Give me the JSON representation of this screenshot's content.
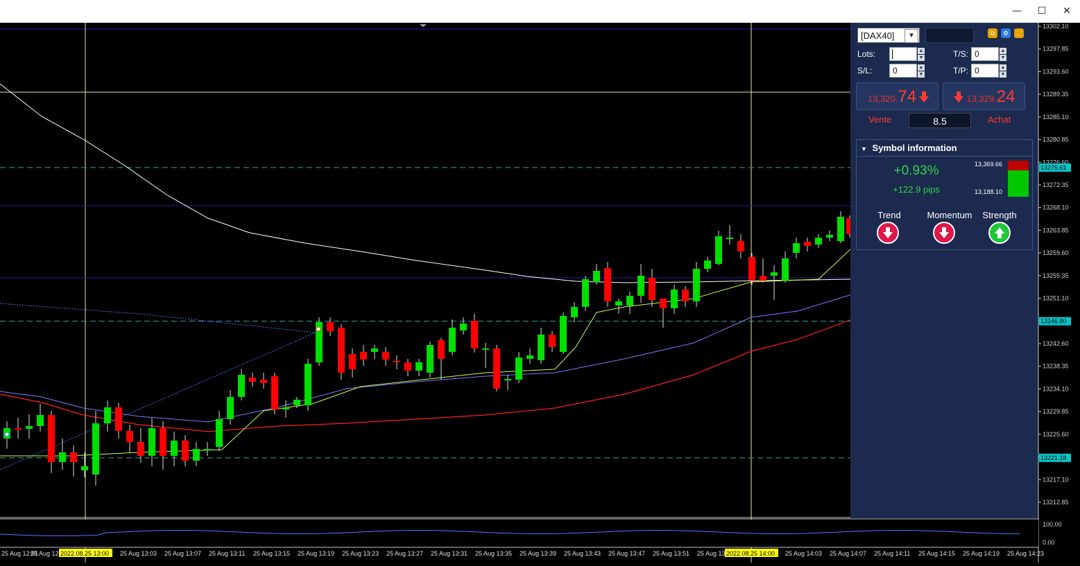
{
  "window": {
    "minimize_glyph": "—",
    "maximize_glyph": "☐",
    "close_glyph": "✕"
  },
  "chart": {
    "price_axis": [
      "13302.10",
      "13297.85",
      "13293.60",
      "13289.35",
      "13285.10",
      "13280.85",
      "13276.60",
      "13272.35",
      "13268.10",
      "13263.85",
      "13259.60",
      "13255.35",
      "13251.10",
      "13246.85",
      "13242.60",
      "13238.35",
      "13234.10",
      "13229.85",
      "13225.60",
      "13221.35",
      "13217.10",
      "13212.85"
    ],
    "price_markers": [
      {
        "value": "13275.61",
        "color": "#00c6c8"
      },
      {
        "value": "13246.80",
        "color": "#00c6c8"
      },
      {
        "value": "13221.18",
        "color": "#00c6c8"
      }
    ],
    "time_axis": [
      "25 Aug 12:51",
      "25 Aug 12",
      "2022.08.25 13:00",
      "25 Aug 13:03",
      "25 Aug 13:07",
      "25 Aug 13:11",
      "25 Aug 13:15",
      "25 Aug 13:19",
      "25 Aug 13:23",
      "25 Aug 13:27",
      "25 Aug 13:31",
      "25 Aug 13:35",
      "25 Aug 13:39",
      "25 Aug 13:43",
      "25 Aug 13:47",
      "25 Aug 13:51",
      "25 Aug 13",
      "2022.08.25 14:00",
      "25 Aug 14:03",
      "25 Aug 14:07",
      "25 Aug 14:11",
      "25 Aug 14:15",
      "25 Aug 14:19",
      "25 Aug 14:23"
    ],
    "highlight_color": "#ffff00",
    "sub_axis": [
      "100.00",
      "0.00"
    ],
    "colors": {
      "bull": "#00e000",
      "bear": "#ff0000",
      "bg": "#000000",
      "ema_fast": "#c8ff50",
      "ema_mid": "#7a7cff",
      "ema_slow": "#ff2020",
      "sma_long": "#ffffff",
      "hline": "#2020a0",
      "dash": "#2fa89c"
    }
  },
  "panel": {
    "symbol": "[DAX40]",
    "lots_label": "Lots:",
    "lots_value": "",
    "ts_label": "T/S:",
    "ts_value": "0",
    "sl_label": "S/L:",
    "sl_value": "0",
    "tp_label": "T/P:",
    "tp_value": "0",
    "sell_price_small": "13,320.",
    "sell_price_big": "74",
    "sell_label": "Vente",
    "buy_price_small": "13,329.",
    "buy_price_big": "24",
    "buy_label": "Achat",
    "spread": "8.5",
    "symbol_info_title": "Symbol information",
    "change_percent": "+0.93%",
    "change_pips": "+122.9 pips",
    "range_high": "13,369.66",
    "range_low": "13,188.10",
    "trend_label": "Trend",
    "momentum_label": "Momentum",
    "strength_label": "Strength",
    "trend_direction": "down",
    "momentum_direction": "down",
    "strength_direction": "up"
  }
}
